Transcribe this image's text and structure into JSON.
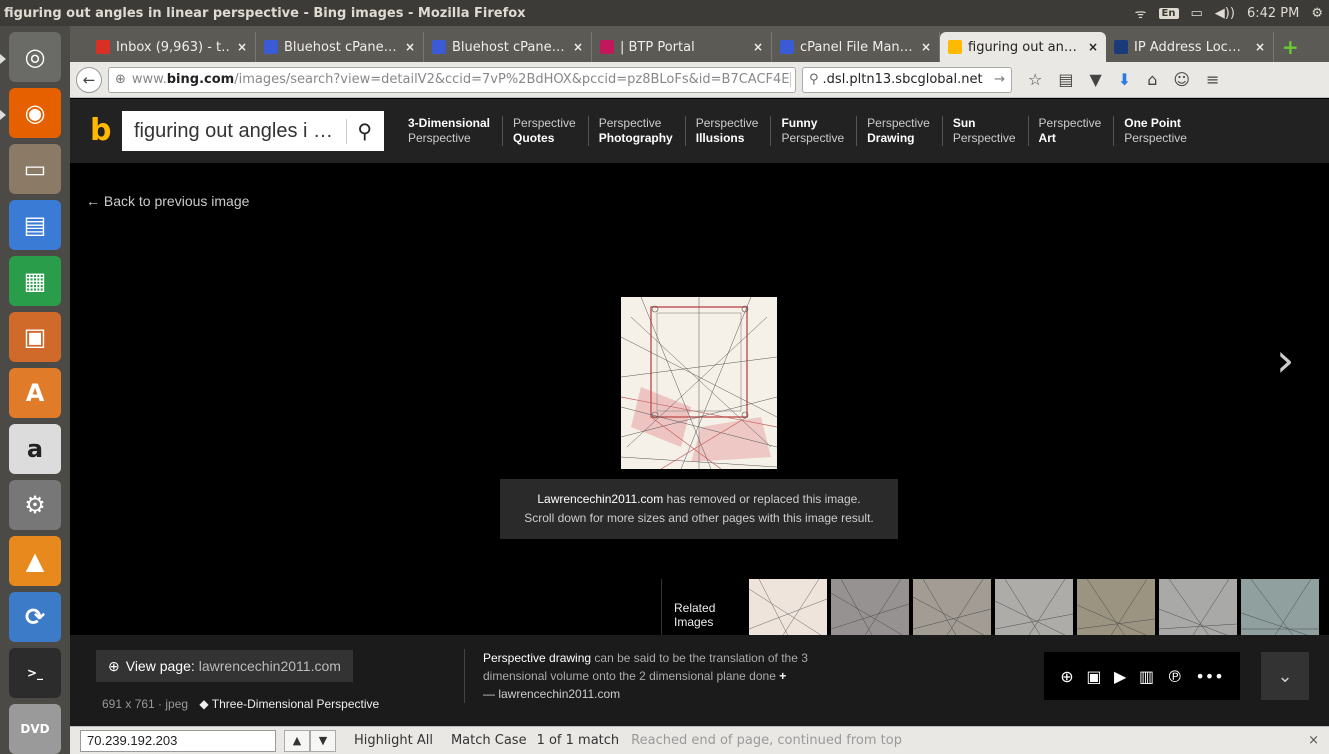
{
  "system": {
    "window_title": "figuring out angles in linear perspective - Bing images - Mozilla Firefox",
    "keyboard": "En",
    "clock": "6:42 PM"
  },
  "launcher": [
    {
      "name": "ubuntu-dash-icon",
      "glyph": "◎",
      "bg": "#6a6a66"
    },
    {
      "name": "firefox-icon",
      "glyph": "◉",
      "bg": "#e66000"
    },
    {
      "name": "files-icon",
      "glyph": "▭",
      "bg": "#8a7a66"
    },
    {
      "name": "writer-icon",
      "glyph": "▤",
      "bg": "#3a7bd5"
    },
    {
      "name": "calc-icon",
      "glyph": "▦",
      "bg": "#2a9d4a"
    },
    {
      "name": "impress-icon",
      "glyph": "▣",
      "bg": "#d06a2a"
    },
    {
      "name": "software-center-icon",
      "glyph": "A",
      "bg": "#e07b2a"
    },
    {
      "name": "amazon-icon",
      "glyph": "a",
      "bg": "#dcdcdc"
    },
    {
      "name": "settings-icon",
      "glyph": "⚙",
      "bg": "#777"
    },
    {
      "name": "vlc-icon",
      "glyph": "▲",
      "bg": "#e8891d"
    },
    {
      "name": "updater-icon",
      "glyph": "⟳",
      "bg": "#3b7bc8"
    },
    {
      "name": "terminal-icon",
      "glyph": ">_",
      "bg": "#2c2c2c"
    },
    {
      "name": "dvd-icon",
      "glyph": "DVD",
      "bg": "#9a9a9a"
    }
  ],
  "tabs": [
    {
      "label": "Inbox (9,963) - t…",
      "color": "#d93025",
      "active": false
    },
    {
      "label": "Bluehost cPane…",
      "color": "#3a5bd5",
      "active": false
    },
    {
      "label": "Bluehost cPane…",
      "color": "#3a5bd5",
      "active": false
    },
    {
      "label": "| BTP Portal",
      "color": "#c2185b",
      "active": false
    },
    {
      "label": "cPanel File Man…",
      "color": "#3a5bd5",
      "active": false
    },
    {
      "label": "figuring out an…",
      "color": "#ffb900",
      "active": true
    },
    {
      "label": "IP Address Loc…",
      "color": "#1a3a7a",
      "active": false
    }
  ],
  "tab_close": "×",
  "new_tab": "+",
  "nav": {
    "url_prefix": "www.",
    "url_host": "bing.com",
    "url_path": "/images/search?view=detailV2&ccid=7vP%2BdHOX&pccid=pz8BLoFs&id=B7CACF4E",
    "search_value": ".dsl.pltn13.sbcglobal.net"
  },
  "bing": {
    "query": "figuring out angles i …",
    "chips": [
      {
        "top": "3-Dimensional",
        "bottom": "Perspective",
        "bold": "top"
      },
      {
        "top": "Perspective",
        "bottom": "Quotes",
        "bold": "bottom"
      },
      {
        "top": "Perspective",
        "bottom": "Photography",
        "bold": "bottom"
      },
      {
        "top": "Perspective",
        "bottom": "Illusions",
        "bold": "bottom"
      },
      {
        "top": "Funny",
        "bottom": "Perspective",
        "bold": "top"
      },
      {
        "top": "Perspective",
        "bottom": "Drawing",
        "bold": "bottom"
      },
      {
        "top": "Sun",
        "bottom": "Perspective",
        "bold": "top"
      },
      {
        "top": "Perspective",
        "bottom": "Art",
        "bold": "bottom"
      },
      {
        "top": "One Point",
        "bottom": "Perspective",
        "bold": "top"
      }
    ]
  },
  "viewer": {
    "back_link": "← Back to previous image",
    "notice_host": "Lawrencechin2011.com",
    "notice_line1": " has removed or replaced this image.",
    "notice_line2": "Scroll down for more sizes and other pages with this image result.",
    "next_arrow": "›",
    "related_label": "Related Images",
    "related_thumbs": [
      "#efe4dc",
      "#c9c3c3",
      "#d8d0c6",
      "#e8e6e2",
      "#cfc6ad",
      "#e2e2e0",
      "#bfd6d4"
    ]
  },
  "info": {
    "view_page_label": "View page:",
    "view_page_host": "lawrencechin2011.com",
    "meta": "691 x 761 · jpeg",
    "tag": "Three-Dimensional Perspective",
    "desc_bold": "Perspective drawing",
    "desc_rest": " can be said to be the translation of the 3 dimensional volume onto the 2 dimensional plane done",
    "desc_more": "+",
    "desc_source": "— lawrencechin2011.com"
  },
  "findbar": {
    "query": "70.239.192.203",
    "highlight_all": "Highlight All",
    "match_case": "Match Case",
    "result": "1 of 1 match",
    "status": "Reached end of page, continued from top",
    "close": "×"
  }
}
